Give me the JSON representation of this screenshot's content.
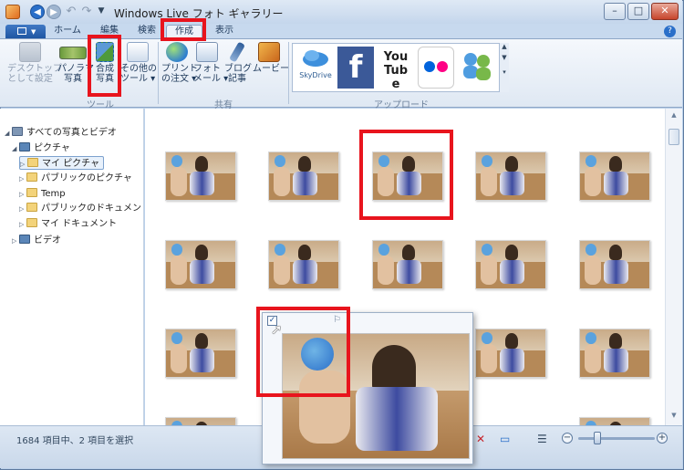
{
  "window": {
    "title": "Windows Live フォト ギャラリー"
  },
  "quick_access": {
    "back_icon": "back-arrow-icon",
    "forward_icon": "forward-arrow-icon",
    "undo_icon": "undo-icon",
    "redo_icon": "redo-icon",
    "menu_icon": "dropdown-icon"
  },
  "tabs": [
    {
      "label": "ホーム"
    },
    {
      "label": "編集"
    },
    {
      "label": "検索"
    },
    {
      "label": "作成",
      "active": true
    },
    {
      "label": "表示"
    }
  ],
  "ribbon": {
    "tools": {
      "group_label": "ツール",
      "desktop_background": "デスクトップ\nとして設定",
      "panorama": "パノラマ\n写真",
      "composite": "合成\n写真",
      "other_tools": "その他の\nツール ▾"
    },
    "share": {
      "group_label": "共有",
      "print_order": "プリント\nの注文 ▾",
      "photo_mail": "フォト\nメール ▾",
      "blog_post": "ブログ\n記事",
      "movie": "ムービー"
    },
    "upload": {
      "group_label": "アップロード",
      "services": [
        {
          "name": "SkyDrive",
          "icon": "skydrive-icon"
        },
        {
          "name": "f",
          "icon": "facebook-icon"
        },
        {
          "name": "You Tube",
          "icon": "youtube-icon"
        },
        {
          "name": "flickr",
          "icon": "flickr-icon"
        },
        {
          "name": "Messenger",
          "icon": "messenger-icon"
        }
      ]
    }
  },
  "sidebar": {
    "items": [
      {
        "label": "すべての写真とビデオ",
        "icon": "gallery-icon"
      },
      {
        "label": "ピクチャ",
        "icon": "pictures-library-icon"
      },
      {
        "label": "マイ ピクチャ",
        "icon": "folder-icon",
        "selected": true
      },
      {
        "label": "パブリックのピクチャ",
        "icon": "folder-icon"
      },
      {
        "label": "Temp",
        "icon": "folder-icon"
      },
      {
        "label": "パブリックのドキュメン",
        "icon": "folder-icon"
      },
      {
        "label": "マイ ドキュメント",
        "icon": "folder-icon"
      },
      {
        "label": "ビデオ",
        "icon": "video-library-icon"
      }
    ]
  },
  "status": {
    "text": "1684 項目中、2 項目を選択",
    "zoom_level": 0.25
  },
  "colors": {
    "highlight": "#e8141d",
    "accent": "#2a6fc9"
  }
}
